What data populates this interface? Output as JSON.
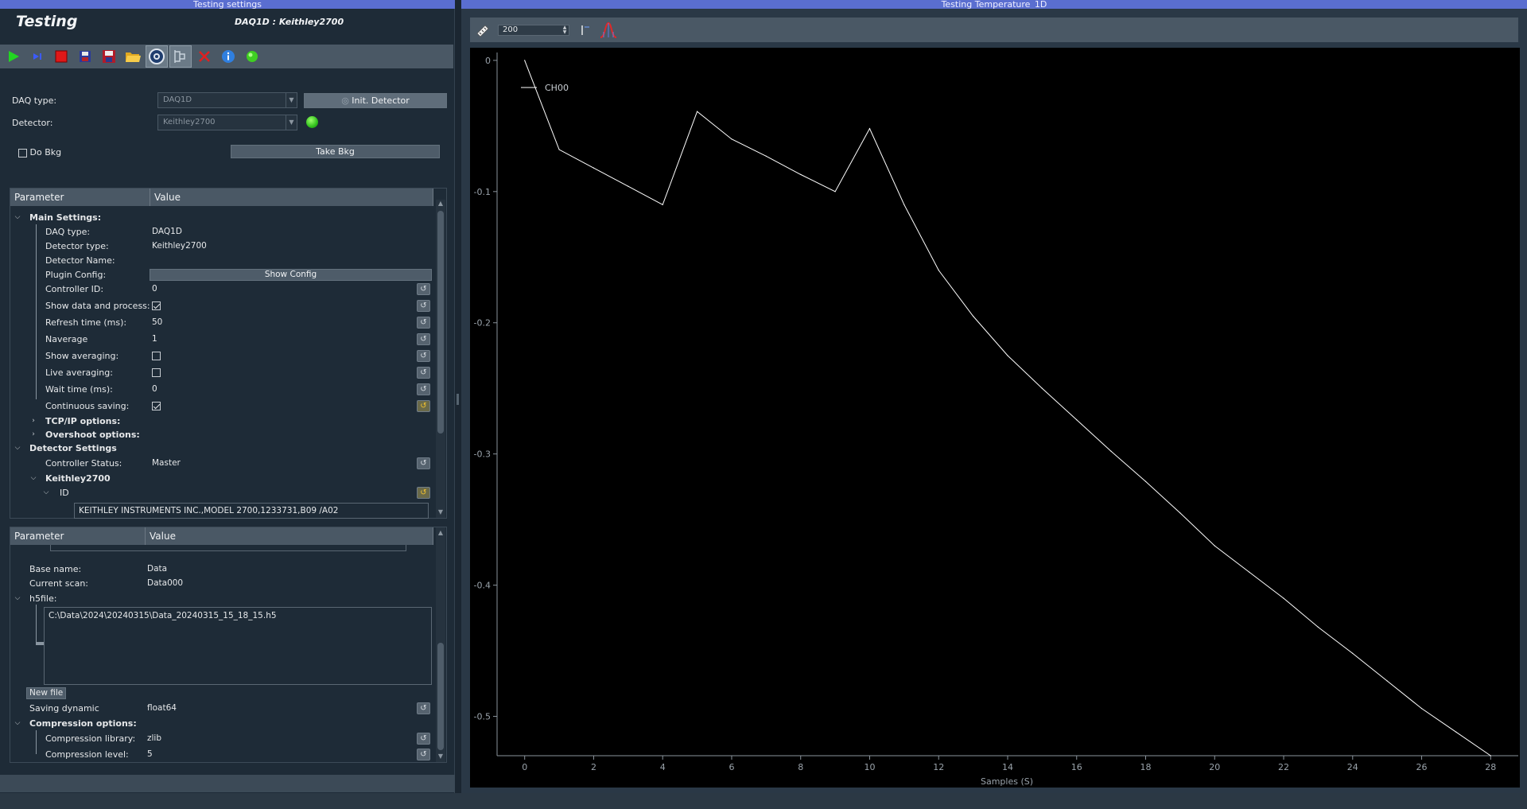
{
  "windows": {
    "left_title": "Testing settings",
    "right_title": "Testing Temperature_1D"
  },
  "app": {
    "title": "Testing",
    "daq_title": "DAQ1D : Keithley2700"
  },
  "toolbar": {
    "buttons": [
      "grab-icon",
      "snap-icon",
      "stop-icon",
      "save-icon",
      "save-current-icon",
      "open-icon",
      "settings-icon",
      "roi-icon",
      "quit-icon",
      "info-icon",
      "status-led-icon"
    ]
  },
  "form": {
    "daq_type_label": "DAQ type:",
    "daq_type_value": "DAQ1D",
    "init_button": "Init. Detector",
    "detector_label": "Detector:",
    "detector_value": "Keithley2700",
    "do_bkg_label": "Do Bkg",
    "take_bkg_button": "Take Bkg"
  },
  "tree1": {
    "headers": [
      "Parameter",
      "Value"
    ],
    "main_settings": "Main Settings:",
    "daq_type_label": "DAQ type:",
    "daq_type_value": "DAQ1D",
    "detector_type_label": "Detector type:",
    "detector_type_value": "Keithley2700",
    "detector_name_label": "Detector Name:",
    "plugin_config_label": "Plugin Config:",
    "show_config_button": "Show Config",
    "controller_id_label": "Controller ID:",
    "controller_id_value": "0",
    "show_data_label": "Show data and process:",
    "show_data_checked": true,
    "refresh_label": "Refresh time (ms):",
    "refresh_value": "50",
    "naverage_label": "Naverage",
    "naverage_value": "1",
    "show_avg_label": "Show averaging:",
    "live_avg_label": "Live averaging:",
    "wait_label": "Wait time (ms):",
    "wait_value": "0",
    "cont_saving_label": "Continuous saving:",
    "cont_saving_checked": true,
    "tcpip_label": "TCP/IP options:",
    "overshoot_label": "Overshoot options:",
    "detector_settings": "Detector Settings",
    "controller_status_label": "Controller Status:",
    "controller_status_value": "Master",
    "keithley_label": "Keithley2700",
    "id_label": "ID",
    "id_value": "KEITHLEY INSTRUMENTS INC.,MODEL 2700,1233731,B09  /A02"
  },
  "tree2": {
    "headers": [
      "Parameter",
      "Value"
    ],
    "base_name_label": "Base name:",
    "base_name_value": "Data",
    "current_scan_label": "Current scan:",
    "current_scan_value": "Data000",
    "h5file_label": "h5file:",
    "h5file_value": "C:\\Data\\2024\\20240315\\Data_20240315_15_18_15.h5",
    "new_file_button": "New file",
    "saving_dynamic_label": "Saving dynamic",
    "saving_dynamic_value": "float64",
    "compression_label": "Compression options:",
    "comp_lib_label": "Compression library:",
    "comp_lib_value": "zlib",
    "comp_level_label": "Compression level:",
    "comp_level_value": "5"
  },
  "viewer": {
    "spin_value": "200"
  },
  "chart_data": {
    "type": "line",
    "xlabel": "Samples (S)",
    "ylabel": "",
    "xlim": [
      -0.8,
      28.8
    ],
    "ylim": [
      -0.53,
      0.006
    ],
    "xticks": [
      0,
      2,
      4,
      6,
      8,
      10,
      12,
      14,
      16,
      18,
      20,
      22,
      24,
      26,
      28
    ],
    "yticks": [
      0,
      -0.1,
      -0.2,
      -0.3,
      -0.4,
      -0.5
    ],
    "xtick_labels": [
      "0",
      "2",
      "4",
      "6",
      "8",
      "10",
      "12",
      "14",
      "16",
      "18",
      "20",
      "22",
      "24",
      "26",
      "28"
    ],
    "ytick_labels": [
      "0",
      "-0.1",
      "-0.2",
      "-0.3",
      "-0.4",
      "-0.5"
    ],
    "grid": false,
    "legend": "top-left",
    "series": [
      {
        "name": "CH00",
        "color": "#ffffff",
        "x": [
          0,
          1,
          2,
          3,
          4,
          5,
          6,
          7,
          8,
          9,
          10,
          11,
          12,
          13,
          14,
          15,
          16,
          17,
          18,
          19,
          20,
          21,
          22,
          23,
          24,
          25,
          26,
          27,
          28
        ],
        "y": [
          0.0,
          -0.068,
          -0.082,
          -0.096,
          -0.11,
          -0.039,
          -0.06,
          -0.073,
          -0.087,
          -0.1,
          -0.052,
          -0.11,
          -0.16,
          -0.195,
          -0.225,
          -0.25,
          -0.274,
          -0.298,
          -0.321,
          -0.345,
          -0.37,
          -0.39,
          -0.41,
          -0.432,
          -0.452,
          -0.473,
          -0.494,
          -0.512,
          -0.53
        ]
      }
    ]
  }
}
